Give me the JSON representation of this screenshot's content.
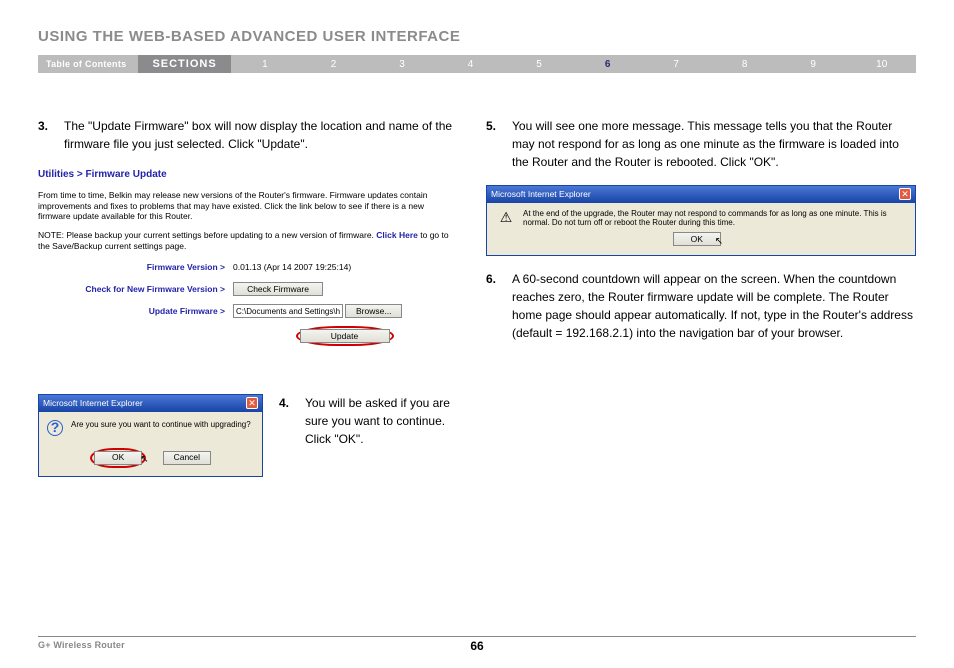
{
  "header": {
    "title": "USING THE WEB-BASED ADVANCED USER INTERFACE"
  },
  "nav": {
    "toc": "Table of Contents",
    "sections_label": "SECTIONS",
    "items": [
      "1",
      "2",
      "3",
      "4",
      "5",
      "6",
      "7",
      "8",
      "9",
      "10"
    ],
    "active": "6"
  },
  "left": {
    "step3": {
      "num": "3.",
      "text": "The \"Update Firmware\" box will now display the location and name of the firmware file you just selected. Click \"Update\"."
    },
    "panel": {
      "breadcrumb": "Utilities > Firmware Update",
      "intro": "From time to time, Belkin may release new versions of the Router's firmware. Firmware updates contain improvements and fixes to problems that may have existed. Click the link below to see if there is a new firmware update available for this Router.",
      "note_prefix": "NOTE: Please backup your current settings before updating to a new version of firmware.",
      "note_link": "Click Here",
      "note_suffix": " to go to the Save/Backup current settings page.",
      "rows": {
        "version_label": "Firmware Version >",
        "version_value": "0.01.13 (Apr 14 2007 19:25:14)",
        "check_label": "Check for New Firmware Version >",
        "check_button": "Check Firmware",
        "update_label": "Update Firmware >",
        "update_path": "C:\\Documents and Settings\\h",
        "browse_button": "Browse...",
        "update_button": "Update"
      }
    },
    "dialog_confirm": {
      "title": "Microsoft Internet Explorer",
      "icon": "?",
      "text": "Are you sure you want to continue with upgrading?",
      "ok": "OK",
      "cancel": "Cancel"
    },
    "step4": {
      "num": "4.",
      "text": "You will be asked if you are sure you want to continue. Click \"OK\"."
    }
  },
  "right": {
    "step5": {
      "num": "5.",
      "text": "You will see one more message. This message tells you that the Router may not respond for as long as one minute as the firmware is loaded into the Router and the Router is rebooted. Click \"OK\"."
    },
    "dialog_warn": {
      "title": "Microsoft Internet Explorer",
      "icon": "!",
      "text": "At the end of the upgrade, the Router may not respond to commands for as long as one minute. This is normal. Do not turn off or reboot the Router during this time.",
      "ok": "OK"
    },
    "step6": {
      "num": "6.",
      "text": "A 60-second countdown will appear on the screen. When the countdown reaches zero, the Router firmware update will be complete. The Router home page should appear automatically. If not, type in the Router's address (default = 192.168.2.1) into the navigation bar of your browser."
    }
  },
  "footer": {
    "product": "G+ Wireless Router",
    "page": "66"
  }
}
